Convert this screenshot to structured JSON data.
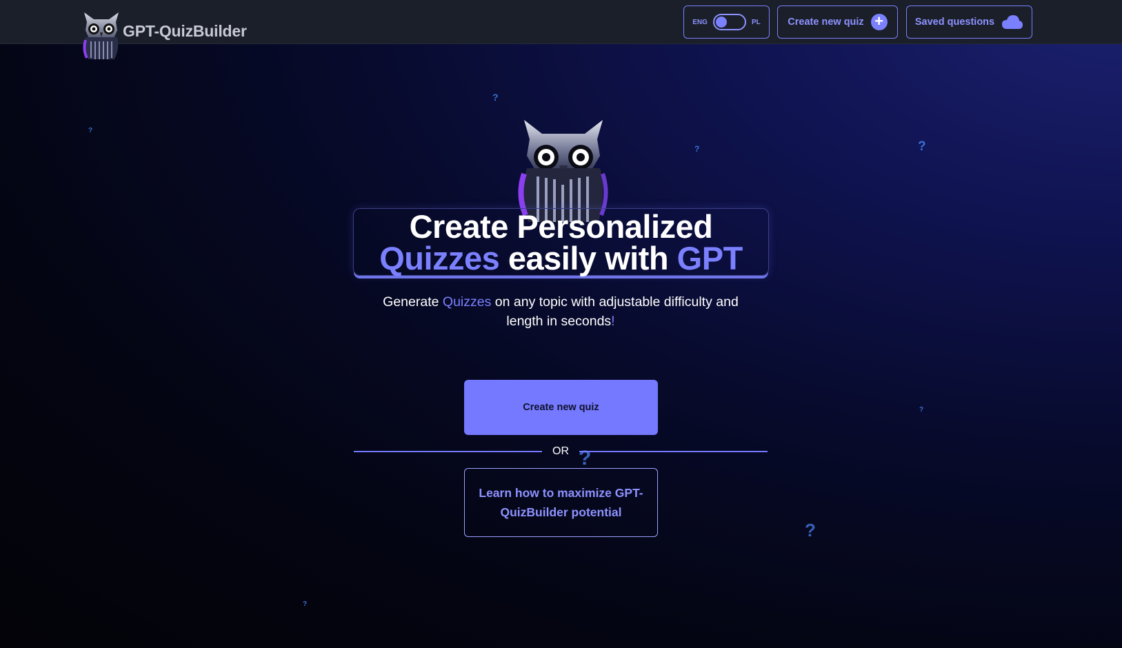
{
  "navbar": {
    "brand_name": "GPT-QuizBuilder",
    "lang_left": "ENG",
    "lang_right": "PL",
    "create_label": "Create new quiz",
    "saved_label": "Saved questions"
  },
  "hero": {
    "title_line1": "Create Personalized",
    "title_accent1": "Quizzes",
    "title_mid": " easily with ",
    "title_accent2": "GPT",
    "subtitle_pre": "Generate ",
    "subtitle_accent": "Quizzes",
    "subtitle_post": " on any topic with adjustable difficulty and length in seconds",
    "subtitle_end": "!",
    "cta_label": "Create new quiz",
    "or_label": "OR",
    "learn_label": "Learn how to maximize GPT-QuizBuilder potential"
  },
  "decor": {
    "question_mark": "?"
  },
  "colors": {
    "accent": "#7479ff",
    "navbar_bg": "#1b1f2a",
    "question_marks": "#3a6fd8"
  }
}
